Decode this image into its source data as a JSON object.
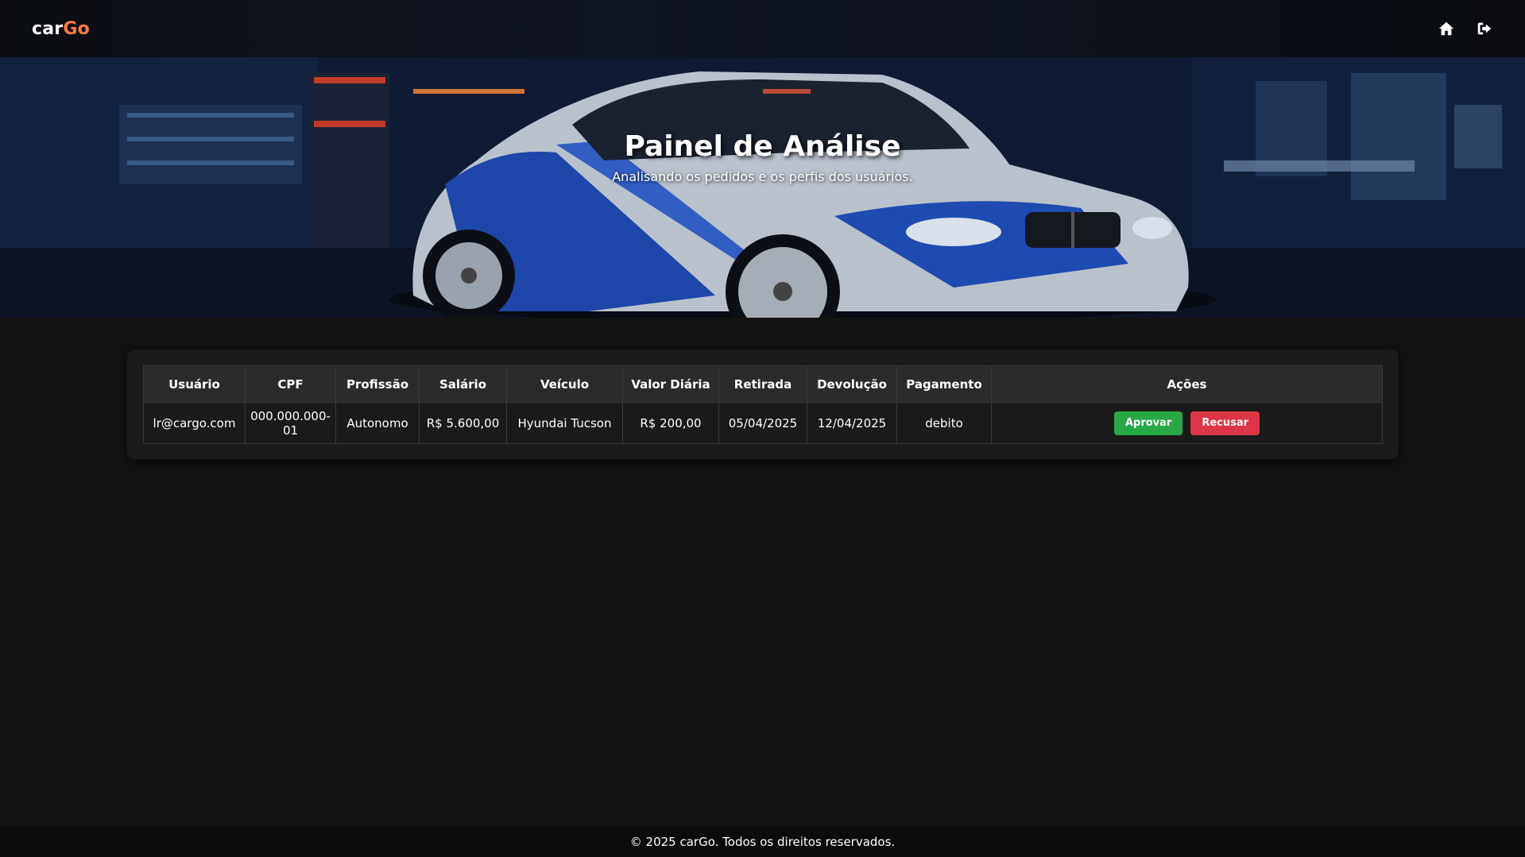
{
  "navbar": {
    "logo_car": "car",
    "logo_go": "Go",
    "icons": [
      "home-icon",
      "logout-icon"
    ]
  },
  "hero": {
    "title": "Painel de Análise",
    "subtitle": "Analisando os pedidos e os perfis dos usuários."
  },
  "table": {
    "headers": [
      "Usuário",
      "CPF",
      "Profissão",
      "Salário",
      "Veículo",
      "Valor Diária",
      "Retirada",
      "Devolução",
      "Pagamento",
      "Ações"
    ],
    "rows": [
      {
        "usuario": "lr@cargo.com",
        "cpf": "000.000.000-01",
        "profissao": "Autonomo",
        "salario": "R$ 5.600,00",
        "veiculo": "Hyundai Tucson",
        "valor_diaria": "R$ 200,00",
        "retirada": "05/04/2025",
        "devolucao": "12/04/2025",
        "pagamento": "debito",
        "approve_label": "Aprovar",
        "reject_label": "Recusar"
      }
    ]
  },
  "footer": {
    "text": "© 2025 carGo. Todos os direitos reservados."
  },
  "colors": {
    "accent": "#ff7a3d",
    "approve": "#28a745",
    "reject": "#dc3545",
    "background": "#121212"
  }
}
